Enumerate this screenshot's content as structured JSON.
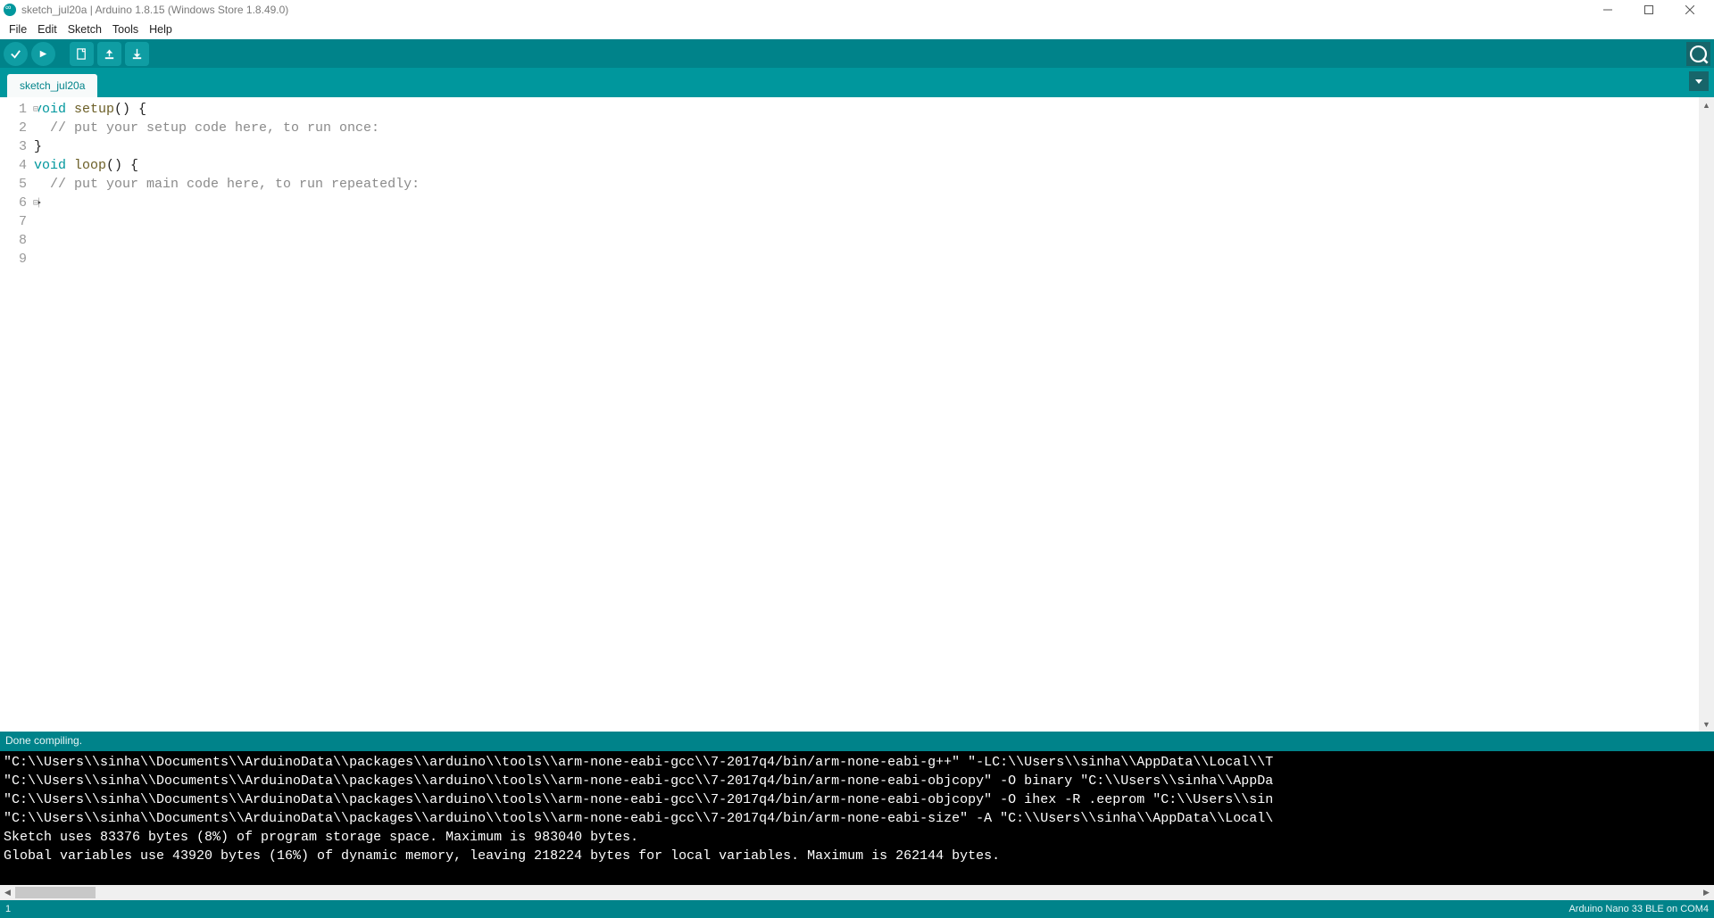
{
  "window": {
    "title": "sketch_jul20a | Arduino 1.8.15 (Windows Store 1.8.49.0)"
  },
  "menu": {
    "items": [
      "File",
      "Edit",
      "Sketch",
      "Tools",
      "Help"
    ]
  },
  "toolbar": {
    "verify": "Verify",
    "upload": "Upload",
    "new": "New",
    "open": "Open",
    "save": "Save",
    "serial": "Serial Monitor"
  },
  "tabs": {
    "active": "sketch_jul20a"
  },
  "editor": {
    "lines": [
      {
        "n": 1,
        "fold": true,
        "tokens": [
          {
            "t": "void ",
            "c": "kw"
          },
          {
            "t": "setup",
            "c": "fn"
          },
          {
            "t": "() {",
            "c": ""
          }
        ]
      },
      {
        "n": 2,
        "tokens": [
          {
            "t": "  // put your setup code here, to run once:",
            "c": "cm"
          }
        ]
      },
      {
        "n": 3,
        "tokens": [
          {
            "t": "",
            "c": ""
          }
        ]
      },
      {
        "n": 4,
        "tokens": [
          {
            "t": "}",
            "c": ""
          }
        ]
      },
      {
        "n": 5,
        "tokens": [
          {
            "t": "",
            "c": ""
          }
        ]
      },
      {
        "n": 6,
        "fold": true,
        "tokens": [
          {
            "t": "void ",
            "c": "kw"
          },
          {
            "t": "loop",
            "c": "fn"
          },
          {
            "t": "() {",
            "c": ""
          }
        ]
      },
      {
        "n": 7,
        "tokens": [
          {
            "t": "  // put your main code here, to run repeatedly:",
            "c": "cm"
          }
        ]
      },
      {
        "n": 8,
        "tokens": [
          {
            "t": "",
            "c": ""
          }
        ]
      },
      {
        "n": 9,
        "tokens": [
          {
            "t": "}",
            "c": ""
          }
        ]
      }
    ]
  },
  "status": {
    "compile": "Done compiling.",
    "line": "1",
    "board": "Arduino Nano 33 BLE on COM4"
  },
  "console": {
    "lines": [
      "\"C:\\\\Users\\\\sinha\\\\Documents\\\\ArduinoData\\\\packages\\\\arduino\\\\tools\\\\arm-none-eabi-gcc\\\\7-2017q4/bin/arm-none-eabi-g++\" \"-LC:\\\\Users\\\\sinha\\\\AppData\\\\Local\\\\T",
      "\"C:\\\\Users\\\\sinha\\\\Documents\\\\ArduinoData\\\\packages\\\\arduino\\\\tools\\\\arm-none-eabi-gcc\\\\7-2017q4/bin/arm-none-eabi-objcopy\" -O binary \"C:\\\\Users\\\\sinha\\\\AppDa",
      "\"C:\\\\Users\\\\sinha\\\\Documents\\\\ArduinoData\\\\packages\\\\arduino\\\\tools\\\\arm-none-eabi-gcc\\\\7-2017q4/bin/arm-none-eabi-objcopy\" -O ihex -R .eeprom \"C:\\\\Users\\\\sin",
      "\"C:\\\\Users\\\\sinha\\\\Documents\\\\ArduinoData\\\\packages\\\\arduino\\\\tools\\\\arm-none-eabi-gcc\\\\7-2017q4/bin/arm-none-eabi-size\" -A \"C:\\\\Users\\\\sinha\\\\AppData\\\\Local\\",
      "Sketch uses 83376 bytes (8%) of program storage space. Maximum is 983040 bytes.",
      "Global variables use 43920 bytes (16%) of dynamic memory, leaving 218224 bytes for local variables. Maximum is 262144 bytes."
    ]
  }
}
